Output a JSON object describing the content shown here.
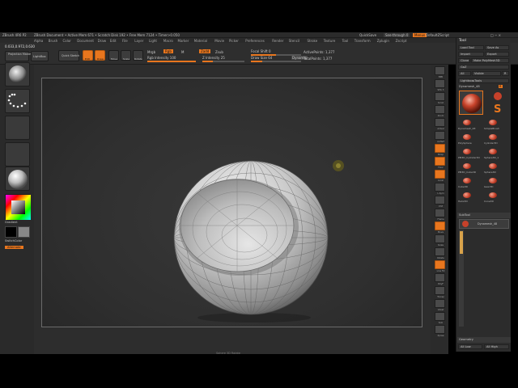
{
  "app": {
    "title_left": "ZBrush 4R6 P2",
    "title_doc": "ZBrush Document",
    "title_info": "• Active Mem 671 • Scratch Disk 192 • Free Mem 7124 • Timer>0.050",
    "quicksave": "QuickSave",
    "see_through": "See-through 0",
    "menus_label": "Menus",
    "default_script": "DefaultZScript"
  },
  "menu": {
    "items": [
      "Alpha",
      "Brush",
      "Color",
      "Document",
      "Draw",
      "Edit",
      "File",
      "Layer",
      "Light",
      "Macro",
      "Marker",
      "Material",
      "Movie",
      "Picker",
      "Preferences",
      "Render",
      "Stencil",
      "Stroke",
      "Texture",
      "Tool",
      "Transform",
      "Zplugin",
      "Zscript"
    ]
  },
  "coords": {
    "readout": "0.033,0.972,0.630"
  },
  "toolbar": {
    "projection_master": "Projection Master",
    "lightbox": "LightBox",
    "quick_sketch": "Quick Sketch",
    "edit": "Edit",
    "draw": "Draw",
    "move": "Move",
    "scale": "Scale",
    "rotate": "Rotate",
    "mrgb": "Mrgb",
    "rgb": "Rgb",
    "m": "M",
    "zadd": "Zadd",
    "zsub": "Zsub",
    "zcut": "Zcut",
    "rgb_intensity": "Rgb Intensity 100",
    "z_intensity": "Z Intensity 25",
    "focal_shift": "Focal Shift 0",
    "draw_size": "Draw Size 64",
    "dynamic": "Dynamic",
    "active_points": "ActivePoints: 1,377",
    "total_points": "TotalPoints: 1,377"
  },
  "left_shelf": {
    "gradient_label": "Gradient",
    "switch_color": "SwitchColor",
    "alternate": "Alternate"
  },
  "canvas": {
    "bottom_hint": "Sphere 3D Rotate"
  },
  "right_icons": [
    "BPR",
    "SPix 3",
    "Scroll",
    "Zoom",
    "Actual",
    "AAHalf",
    "Persp",
    "Floor",
    "Local",
    "L.Sym",
    "XYZ",
    "Frame",
    "Move",
    "Scale",
    "Rotate",
    "Line Fill",
    "PolyF",
    "Transp",
    "Ghost",
    "Solo",
    "Xpose"
  ],
  "tool_panel": {
    "header": "Tool",
    "load_tool": "Load Tool",
    "save_as": "Save As",
    "import": "Import",
    "export": "Export",
    "clone": "Clone",
    "make_polymesh": "Make PolyMesh3D",
    "goz": "GoZ",
    "all": "All",
    "visible": "Visible",
    "r": "R",
    "lightbox_tools": "Lightbox▸Tools",
    "current_tool": "Dynamesh_48",
    "r_value": "R",
    "tools": [
      {
        "label": "Dynamesh_48"
      },
      {
        "label": "SimpleBrush"
      },
      {
        "label": "PolySphere"
      },
      {
        "label": "Cylinder3D"
      },
      {
        "label": "PM3D_Cylinder3D"
      },
      {
        "label": "Sphere3D_1"
      },
      {
        "label": "PM3D_Cube3D"
      },
      {
        "label": "Sphere3D"
      },
      {
        "label": "Cube3D"
      },
      {
        "label": "Gear3D"
      },
      {
        "label": "Helix3D"
      },
      {
        "label": "Cone3D"
      }
    ],
    "subtool_header": "SubTool",
    "subtool_item": "Dynamesh_48",
    "geometry": "Geometry",
    "lo_res": "All Low",
    "hi_res": "All High"
  },
  "colors": {
    "accent": "#e8761e",
    "panel": "#2c2c2c",
    "canvas_bg": "#2f2f2f",
    "frame": "#6a6a6a"
  }
}
